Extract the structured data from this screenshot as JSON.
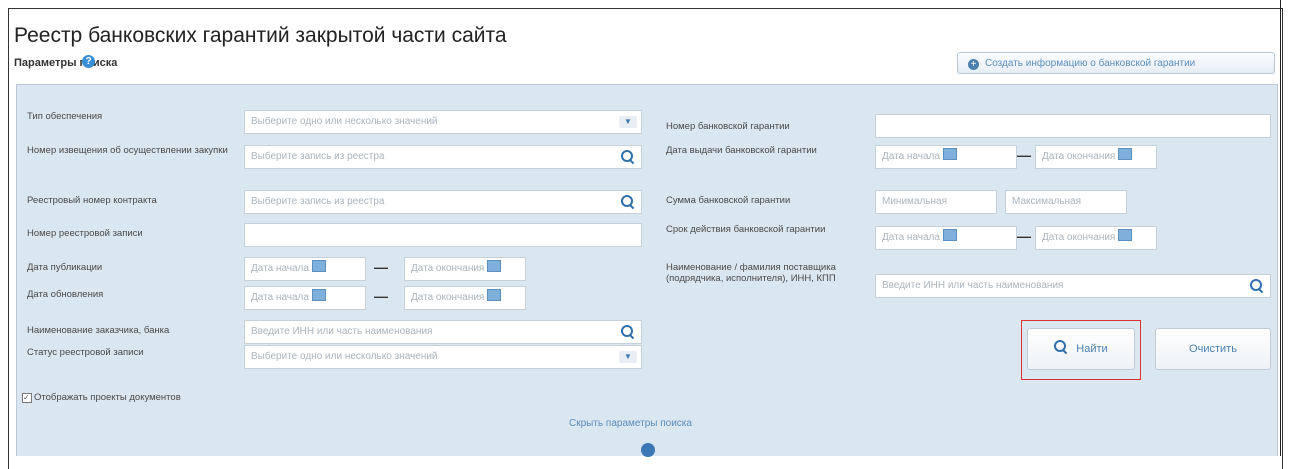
{
  "page": {
    "title": "Реестр банковских гарантий закрытой части сайта",
    "params_label": "Параметры поиска",
    "create_button": "Создать информацию о банковской гарантии"
  },
  "left": {
    "security_type": {
      "label": "Тип обеспечения",
      "placeholder": "Выберите одно или несколько значений"
    },
    "notice_number": {
      "label": "Номер извещения об осуществлении закупки",
      "placeholder": "Выберите запись из реестра"
    },
    "contract_number": {
      "label": "Реестровый номер контракта",
      "placeholder": "Выберите запись из реестра"
    },
    "registry_entry_number": {
      "label": "Номер реестровой записи",
      "value": ""
    },
    "publish_date": {
      "label": "Дата публикации",
      "start": "Дата начала",
      "end": "Дата окончания"
    },
    "update_date": {
      "label": "Дата обновления",
      "start": "Дата начала",
      "end": "Дата окончания"
    },
    "customer_bank": {
      "label": "Наименование заказчика, банка",
      "placeholder": "Введите ИНН или часть наименования"
    },
    "entry_status": {
      "label": "Статус реестровой записи",
      "placeholder": "Выберите одно или несколько значений"
    },
    "show_drafts": {
      "label": "Отображать проекты документов",
      "checked": true
    }
  },
  "right": {
    "guarantee_number": {
      "label": "Номер банковской гарантии",
      "value": ""
    },
    "issue_date": {
      "label": "Дата выдачи банковской гарантии",
      "start": "Дата начала",
      "end": "Дата окончания"
    },
    "amount": {
      "label": "Сумма банковской гарантии",
      "min": "Минимальная",
      "max": "Максимальная"
    },
    "validity": {
      "label": "Срок действия банковской гарантии",
      "start": "Дата начала",
      "end": "Дата окончания"
    },
    "supplier": {
      "label": "Наименование / фамилия поставщика (подрядчика, исполнителя), ИНН, КПП",
      "placeholder": "Введите ИНН или часть наименования"
    }
  },
  "actions": {
    "find": "Найти",
    "clear": "Очистить",
    "toggle_params": "Скрыть параметры поиска"
  },
  "colors": {
    "panel": "#dae6f0",
    "accent": "#2f6fab",
    "highlight": "#e03030"
  }
}
